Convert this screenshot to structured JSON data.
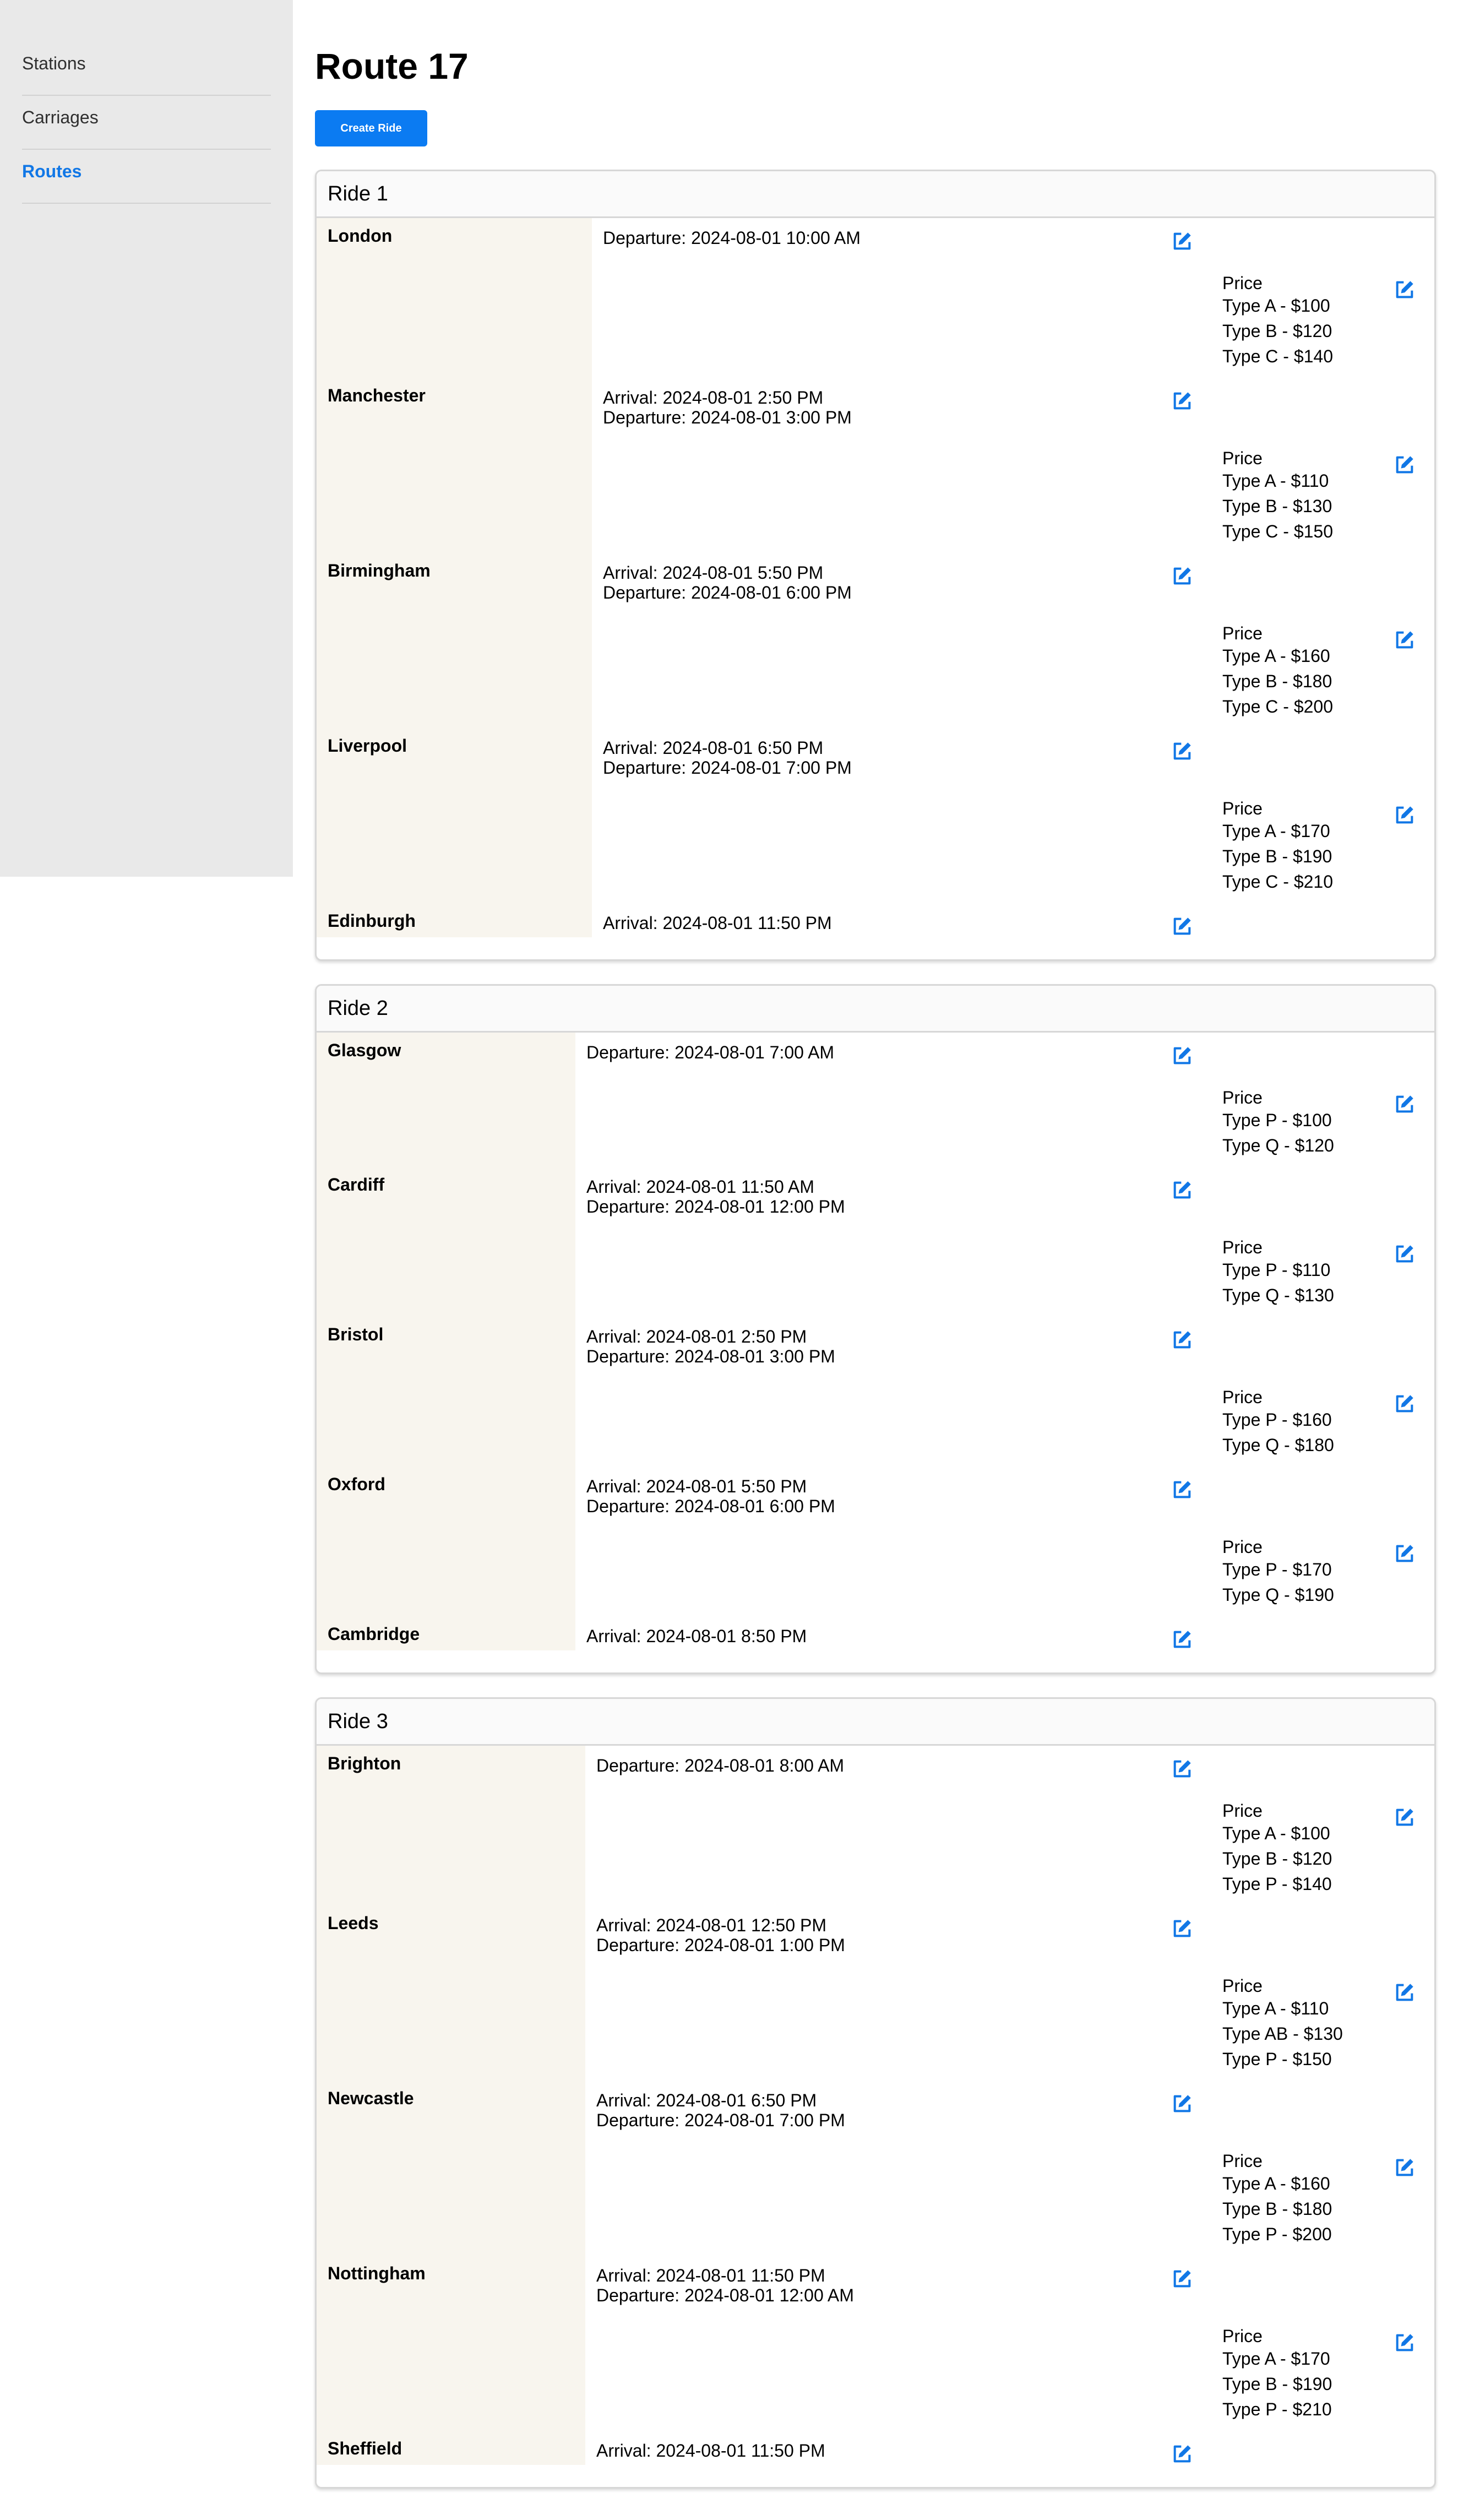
{
  "sidebar": {
    "items": [
      {
        "label": "Stations",
        "active": false
      },
      {
        "label": "Carriages",
        "active": false
      },
      {
        "label": "Routes",
        "active": true
      }
    ]
  },
  "page": {
    "title": "Route 17",
    "create_button": "Create Ride",
    "price_heading": "Price"
  },
  "icons": {
    "edit": "edit-square-pencil-icon",
    "accent": "#1177e6"
  },
  "rides": [
    {
      "title": "Ride 1",
      "stops": [
        {
          "station": "London",
          "times": [
            "Departure: 2024-08-01 10:00 AM"
          ],
          "prices": [
            "Type A - $100",
            "Type B - $120",
            "Type C - $140"
          ]
        },
        {
          "station": "Manchester",
          "times": [
            "Arrival: 2024-08-01 2:50 PM",
            "Departure: 2024-08-01 3:00 PM"
          ],
          "prices": [
            "Type A - $110",
            "Type B - $130",
            "Type C - $150"
          ]
        },
        {
          "station": "Birmingham",
          "times": [
            "Arrival: 2024-08-01 5:50 PM",
            "Departure: 2024-08-01 6:00 PM"
          ],
          "prices": [
            "Type A - $160",
            "Type B - $180",
            "Type C - $200"
          ]
        },
        {
          "station": "Liverpool",
          "times": [
            "Arrival: 2024-08-01 6:50 PM",
            "Departure: 2024-08-01 7:00 PM"
          ],
          "prices": [
            "Type A - $170",
            "Type B - $190",
            "Type C - $210"
          ]
        },
        {
          "station": "Edinburgh",
          "times": [
            "Arrival: 2024-08-01 11:50 PM"
          ],
          "prices": []
        }
      ]
    },
    {
      "title": "Ride 2",
      "stops": [
        {
          "station": "Glasgow",
          "times": [
            "Departure: 2024-08-01 7:00 AM"
          ],
          "prices": [
            "Type P - $100",
            "Type Q - $120"
          ]
        },
        {
          "station": "Cardiff",
          "times": [
            "Arrival: 2024-08-01 11:50 AM",
            "Departure: 2024-08-01 12:00 PM"
          ],
          "prices": [
            "Type P - $110",
            "Type Q - $130"
          ]
        },
        {
          "station": "Bristol",
          "times": [
            "Arrival: 2024-08-01 2:50 PM",
            "Departure: 2024-08-01 3:00 PM"
          ],
          "prices": [
            "Type P - $160",
            "Type Q - $180"
          ]
        },
        {
          "station": "Oxford",
          "times": [
            "Arrival: 2024-08-01 5:50 PM",
            "Departure: 2024-08-01 6:00 PM"
          ],
          "prices": [
            "Type P - $170",
            "Type Q - $190"
          ]
        },
        {
          "station": "Cambridge",
          "times": [
            "Arrival: 2024-08-01 8:50 PM"
          ],
          "prices": []
        }
      ]
    },
    {
      "title": "Ride 3",
      "stops": [
        {
          "station": "Brighton",
          "times": [
            "Departure: 2024-08-01 8:00 AM"
          ],
          "prices": [
            "Type A - $100",
            "Type B - $120",
            "Type P - $140"
          ]
        },
        {
          "station": "Leeds",
          "times": [
            "Arrival: 2024-08-01 12:50 PM",
            "Departure: 2024-08-01 1:00 PM"
          ],
          "prices": [
            "Type A - $110",
            "Type AB - $130",
            "Type P - $150"
          ]
        },
        {
          "station": "Newcastle",
          "times": [
            "Arrival: 2024-08-01 6:50 PM",
            "Departure: 2024-08-01 7:00 PM"
          ],
          "prices": [
            "Type A - $160",
            "Type B - $180",
            "Type P - $200"
          ]
        },
        {
          "station": "Nottingham",
          "times": [
            "Arrival: 2024-08-01 11:50 PM",
            "Departure: 2024-08-01 12:00 AM"
          ],
          "prices": [
            "Type A - $170",
            "Type B - $190",
            "Type P - $210"
          ]
        },
        {
          "station": "Sheffield",
          "times": [
            "Arrival: 2024-08-01 11:50 PM"
          ],
          "prices": []
        }
      ]
    }
  ]
}
